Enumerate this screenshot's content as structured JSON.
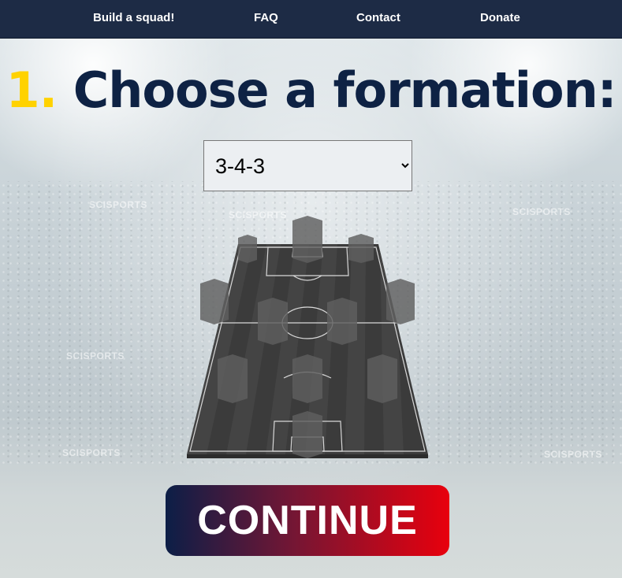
{
  "nav": {
    "items": [
      {
        "label": "Build a squad!"
      },
      {
        "label": "FAQ"
      },
      {
        "label": "Contact"
      },
      {
        "label": "Donate"
      }
    ]
  },
  "heading": {
    "step_number": "1.",
    "text": "Choose a formation:"
  },
  "formation_select": {
    "value": "3-4-3",
    "options": [
      "3-4-3"
    ]
  },
  "watermarks": [
    "SCISPORTS",
    "SCISPORTS",
    "SCISPORTS",
    "SCISPORTS",
    "SCISPORTS",
    "SCISPORTS"
  ],
  "pitch": {
    "formation_rows": [
      3,
      4,
      3,
      1
    ]
  },
  "continue_button": {
    "label": "CONTINUE"
  },
  "colors": {
    "nav_bg": "#1d2b45",
    "title": "#0e2244",
    "step_number": "#ffd200",
    "button_start": "#0c1e47",
    "button_end": "#e8000d"
  }
}
